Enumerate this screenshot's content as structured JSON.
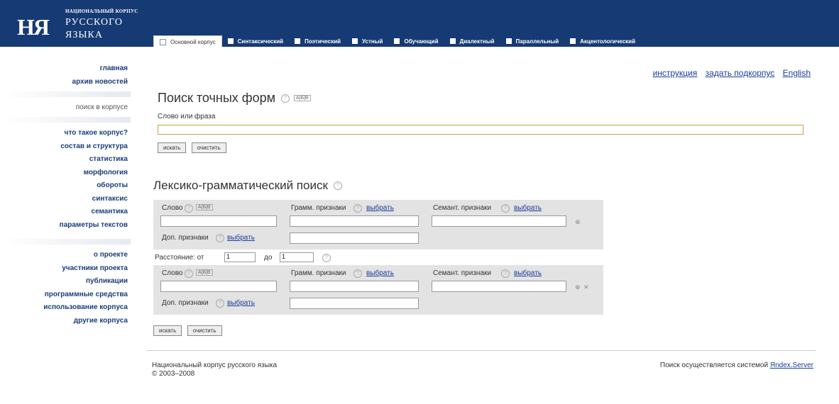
{
  "logo": {
    "small": "НАЦИОНАЛЬНЫЙ КОРПУС",
    "line1": "РУССКОГО",
    "line2": "ЯЗЫКА",
    "mark": "НЯ"
  },
  "tabs": [
    "Основной корпус",
    "Синтаксический",
    "Поэтический",
    "Устный",
    "Обучающий",
    "Диалектный",
    "Параллельный",
    "Акцентологический"
  ],
  "sidebar": {
    "group1": [
      "главная",
      "архив новостей"
    ],
    "current": "поиск в корпусе",
    "group2": [
      "что такое корпус?",
      "состав и структура",
      "статистика",
      "морфология",
      "обороты",
      "синтаксис",
      "семантика",
      "параметры текстов"
    ],
    "group3": [
      "о проекте",
      "участники проекта",
      "публикации",
      "программные средства",
      "использование корпуса",
      "другие корпуса"
    ]
  },
  "toplinks": {
    "instr": "инструкция",
    "sub": "задать подкорпус",
    "lang": "English"
  },
  "exact": {
    "title": "Поиск точных форм",
    "label": "Слово или фраза",
    "search": "искать",
    "clear": "очистить"
  },
  "lex": {
    "title": "Лексико-грамматический поиск",
    "word": "Слово",
    "gramm": "Грамм. признаки",
    "sem": "Семант. признаки",
    "choose": "выбрать",
    "add": "Доп. признаки",
    "dist_from": "Расстояние: от",
    "dist_to": "до",
    "from_val": "1",
    "to_val": "1",
    "search": "искать",
    "clear": "очистить",
    "abv": "А|Б|В",
    "q": "?"
  },
  "footer": {
    "name": "Национальный корпус русского языка",
    "years": "© 2003–2008",
    "engine": "Поиск осуществляется системой",
    "engine_link": "Яndex.Server"
  },
  "colors": {
    "header": "#163a73",
    "link": "#1a3d9a",
    "panel": "#e3e3e3"
  }
}
